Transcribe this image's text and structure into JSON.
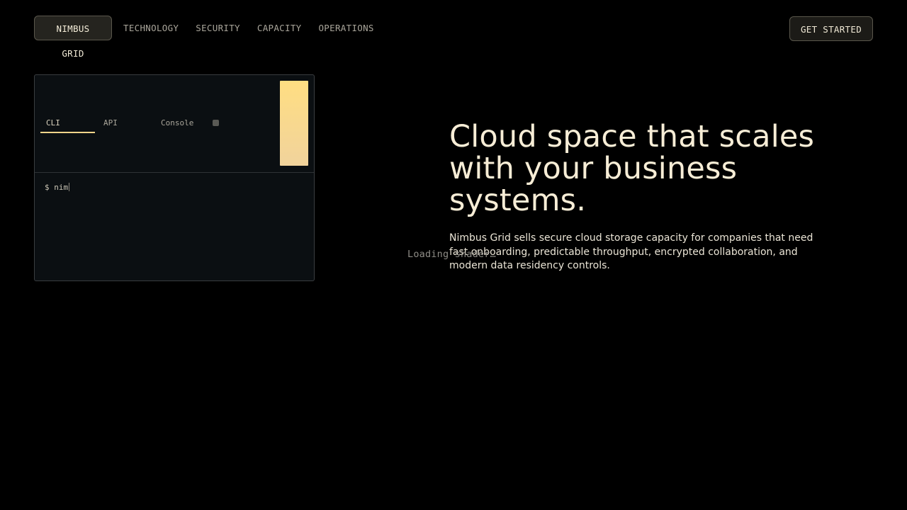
{
  "nav": {
    "brand": "NIMBUS GRID",
    "links": [
      "TECHNOLOGY",
      "SECURITY",
      "CAPACITY",
      "OPERATIONS"
    ],
    "cta": "GET STARTED"
  },
  "terminal": {
    "tabs": [
      "CLI",
      "API",
      "Console"
    ],
    "active_tab": "CLI",
    "prompt": "$ nim",
    "accent_colors": [
      "#ffde82",
      "#f1d39c"
    ]
  },
  "hero": {
    "title": "Cloud space that scales with your business systems.",
    "subtitle": "Nimbus Grid sells secure cloud storage capacity for companies that need fast onboarding, predictable throughput, encrypted collaboration, and modern data residency controls."
  },
  "loading_text": "Loading shader…"
}
